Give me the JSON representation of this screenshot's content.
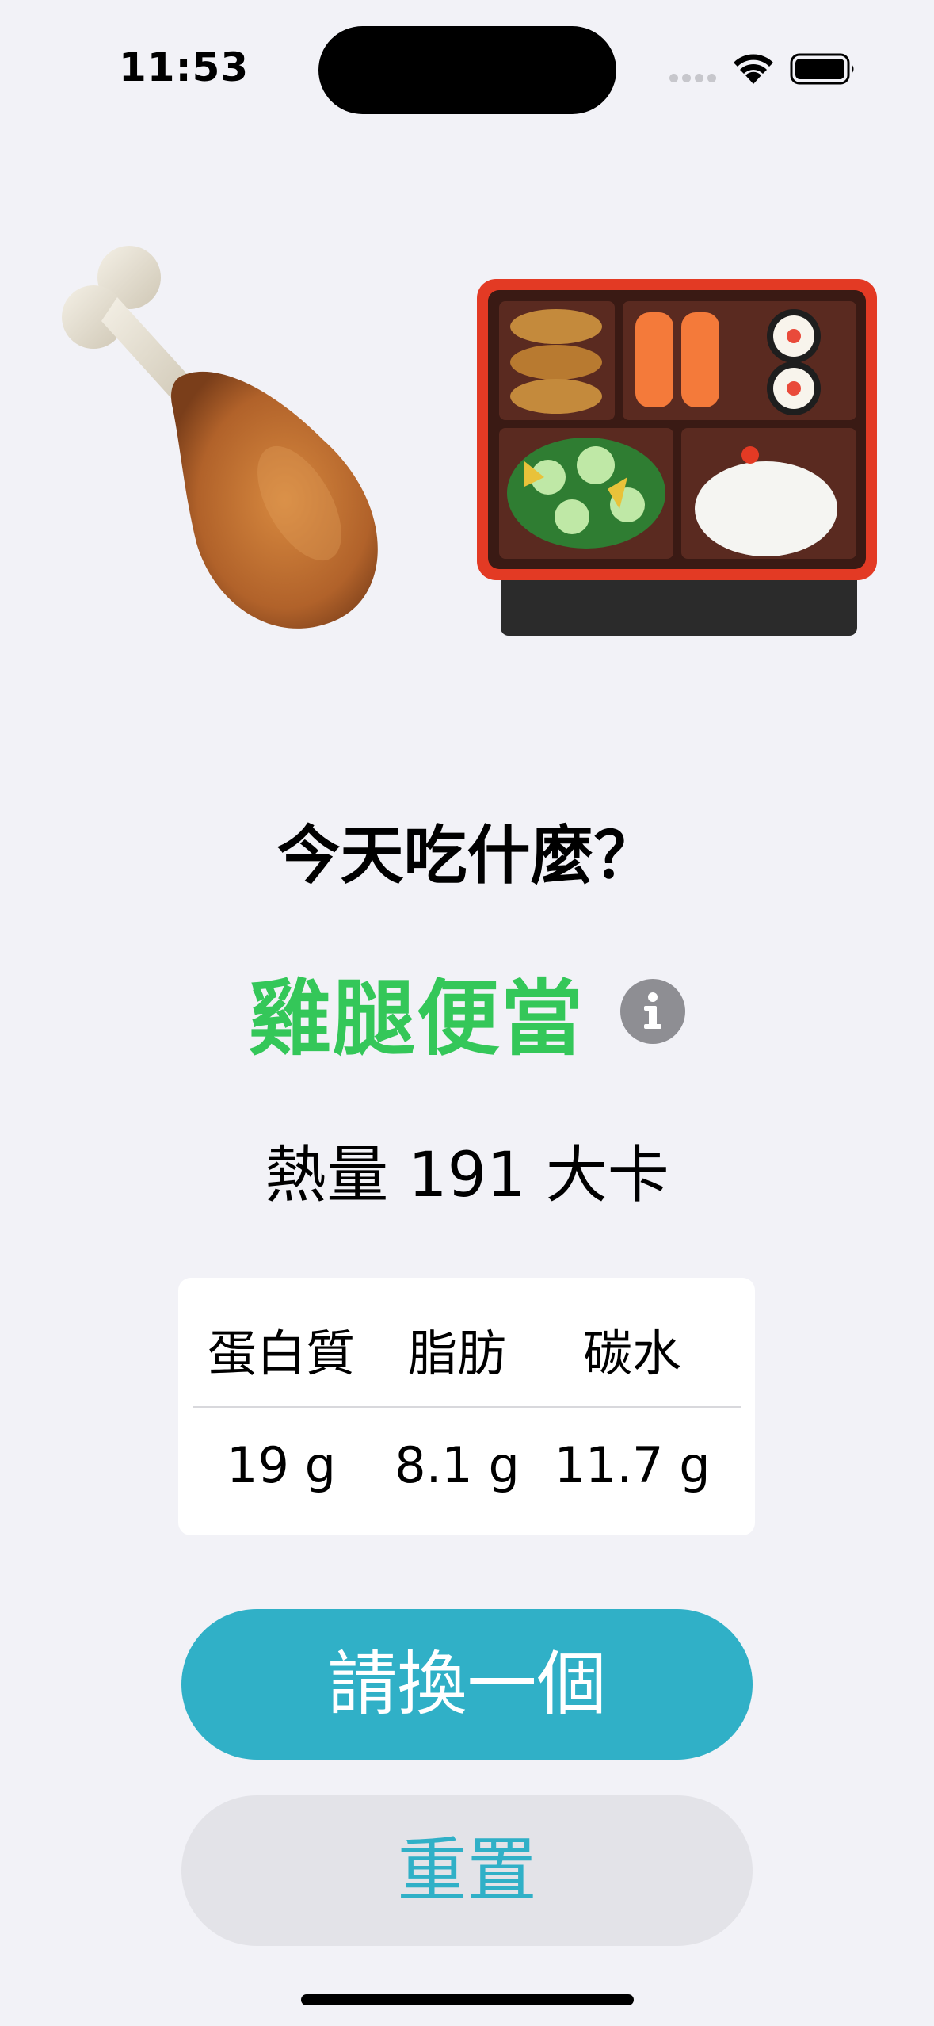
{
  "status_bar": {
    "time": "11:53"
  },
  "icons": {
    "drumstick": "poultry-leg-emoji",
    "bento": "bento-box-emoji",
    "info": "info-circle-icon",
    "wifi": "wifi-icon",
    "battery": "battery-icon",
    "cellular": "cellular-signal-icon"
  },
  "main": {
    "prompt": "今天吃什麼？",
    "meal_name": "雞腿便當",
    "calories": "熱量 191 大卡"
  },
  "nutrition": {
    "headers": [
      "蛋白質",
      "脂肪",
      "碳水"
    ],
    "values": [
      "19 g",
      "8.1 g",
      "11.7 g"
    ]
  },
  "buttons": {
    "next": "請換一個",
    "reset": "重置"
  },
  "colors": {
    "background": "#F2F2F7",
    "meal_name": "#34C759",
    "primary_button": "#30B0C7",
    "secondary_button": "#E3E3E8",
    "info_icon": "#8E8E93"
  }
}
